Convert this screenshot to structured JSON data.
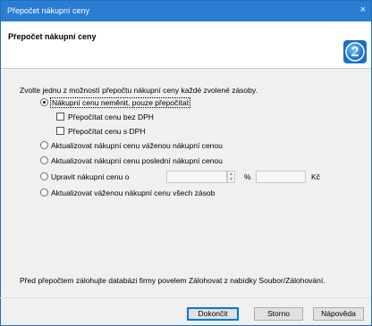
{
  "window": {
    "title": "Přepočet nákupní ceny",
    "close_glyph": "×"
  },
  "header": {
    "title": "Přepočet nákupní ceny",
    "logo_icon": "help-badge-icon"
  },
  "intro": "Zvolte jednu z možností přepočtu nákupní ceny každé zvolené zásoby.",
  "options": {
    "keep": "Nákupní cenu neměnit, pouze přepočítat",
    "without_vat": "Přepočítat cenu bez DPH",
    "with_vat": "Přepočítat cenu s DPH",
    "weighted": "Aktualizovat nákupní cenu váženou nákupní cenou",
    "last": "Aktualizovat nákupní cenu poslední nákupní cenou",
    "adjust": "Upravit nákupní cenu o",
    "all_weighted": "Aktualizovat váženou nákupní cenu všech zásob"
  },
  "adjust": {
    "percent_value": "",
    "percent_unit": "%",
    "amount_value": "",
    "amount_unit": "Kč"
  },
  "note": "Před přepočtem zálohujte databázi firmy povelem Zálohovat z nabídky Soubor/Zálohování.",
  "buttons": {
    "finish": "Dokončit",
    "cancel": "Storno",
    "help": "Nápověda"
  },
  "colors": {
    "titlebar": "#2b7cd3",
    "accent": "#0078d7"
  }
}
